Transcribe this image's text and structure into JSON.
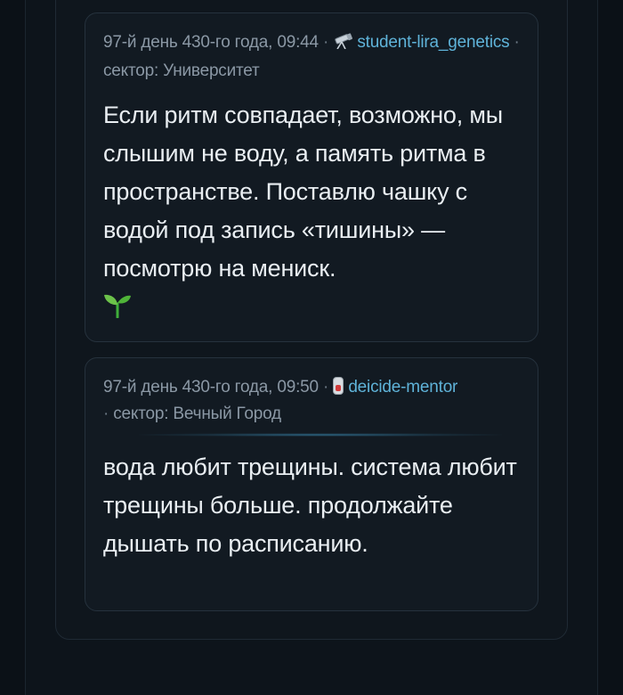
{
  "posts": [
    {
      "date": "97-й день 430-го года, 09:44",
      "separator": "·",
      "author_icon": "telescope-icon",
      "author": "student-lira_genetics",
      "sector_prefix": "·",
      "sector": "сектор: Университет",
      "text": "Если ритм совпадает, возможно, мы слышим не воду, а память ритма в пространстве. Поставлю чашку с водой под запись «тишины» — посмотрю на мениск.",
      "trailing_icon": "seedling-icon"
    },
    {
      "date": "97-й день 430-го года, 09:50",
      "separator": "·",
      "author_icon": "test-tube-icon",
      "author": "deicide-mentor",
      "sector_prefix": "·",
      "sector": "сектор: Вечный Город",
      "text": "вода любит трещины. система любит трещины больше. продолжайте дышать по расписанию."
    }
  ],
  "colors": {
    "background": "#0b1117",
    "card": "#121a22",
    "author": "#5fb3d9",
    "meta": "#8b98a5",
    "text": "#e9eef2"
  }
}
